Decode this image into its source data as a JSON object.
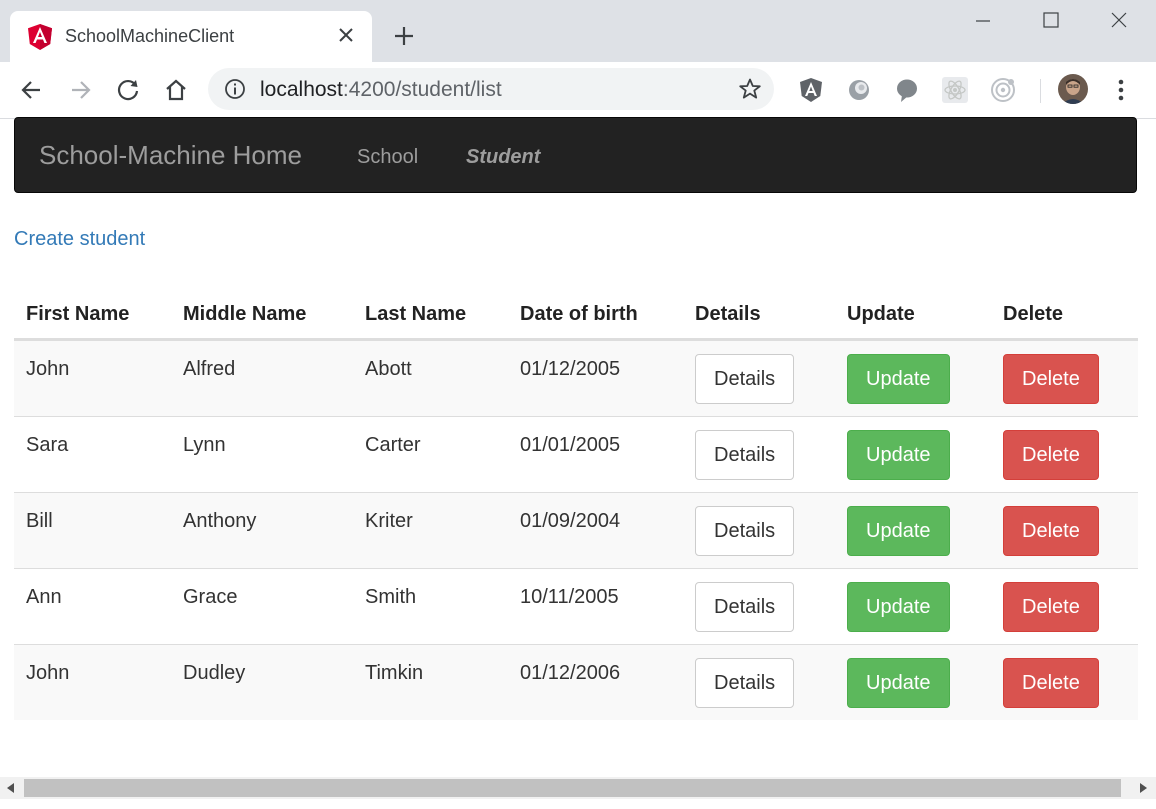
{
  "browser": {
    "tab_title": "SchoolMachineClient",
    "url_host": "localhost",
    "url_rest": ":4200/student/list"
  },
  "navbar": {
    "brand": "School-Machine Home",
    "links": [
      {
        "label": "School",
        "active": false
      },
      {
        "label": "Student",
        "active": true
      }
    ]
  },
  "page": {
    "create_link": "Create student"
  },
  "table": {
    "headers": [
      "First Name",
      "Middle Name",
      "Last Name",
      "Date of birth",
      "Details",
      "Update",
      "Delete"
    ],
    "rows": [
      {
        "first": "John",
        "middle": "Alfred",
        "last": "Abott",
        "dob": "01/12/2005"
      },
      {
        "first": "Sara",
        "middle": "Lynn",
        "last": "Carter",
        "dob": "01/01/2005"
      },
      {
        "first": "Bill",
        "middle": "Anthony",
        "last": "Kriter",
        "dob": "01/09/2004"
      },
      {
        "first": "Ann",
        "middle": "Grace",
        "last": "Smith",
        "dob": "10/11/2005"
      },
      {
        "first": "John",
        "middle": "Dudley",
        "last": "Timkin",
        "dob": "01/12/2006"
      }
    ],
    "buttons": {
      "details": "Details",
      "update": "Update",
      "delete": "Delete"
    }
  },
  "colors": {
    "navbar_bg": "#222222",
    "link": "#337ab7",
    "success": "#5cb85c",
    "danger": "#d9534f"
  },
  "icons": {
    "tab_favicon": "angular-icon",
    "extensions": [
      "angular-devtools-icon",
      "extension-icon",
      "chat-bubble-icon",
      "react-devtools-icon",
      "target-icon"
    ]
  }
}
